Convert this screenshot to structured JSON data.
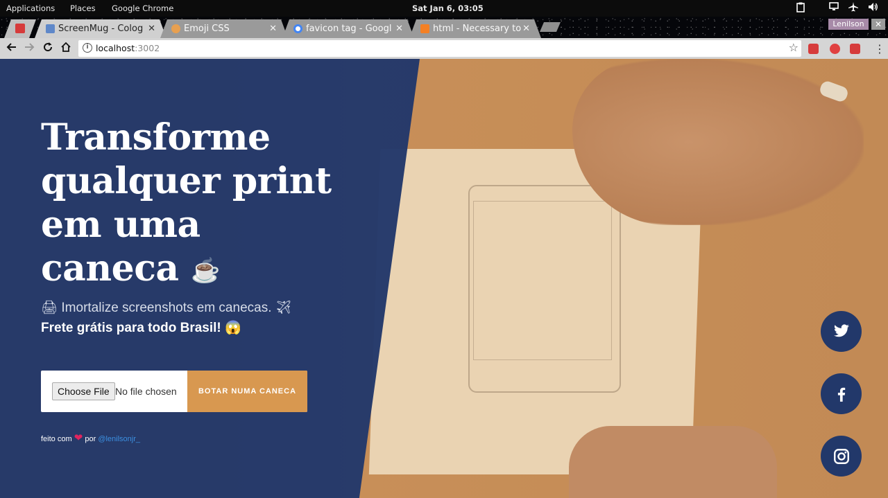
{
  "system_bar": {
    "menus": [
      "Applications",
      "Places",
      "Google Chrome"
    ],
    "clock": "Sat Jan  6, 03:05"
  },
  "browser": {
    "tabs": [
      {
        "title": "ScreenMug - Colog",
        "active": true,
        "favicon_color": "#4a6fb5"
      },
      {
        "title": "Emoji CSS",
        "active": false,
        "favicon_color": "#e8a050"
      },
      {
        "title": "favicon tag - Googl",
        "active": false,
        "favicon_color": "#4285f4"
      },
      {
        "title": "html - Necessary to",
        "active": false,
        "favicon_color": "#f48024"
      }
    ],
    "profile_name": "Lenilson",
    "url_host": "localhost",
    "url_port": ":3002"
  },
  "hero": {
    "title_lines": [
      "Transforme",
      "qualquer print",
      "em uma",
      "caneca"
    ],
    "title_emoji": "☕",
    "subtitle_emoji_1": "🖨",
    "subtitle_text": "Imortalize screenshots em canecas.",
    "subtitle_emoji_2": "✈",
    "subtitle_bold": "Frete grátis para todo Brasil!",
    "subtitle_emoji_3": "😱"
  },
  "upload": {
    "choose_label": "Choose File",
    "no_file_label": "No file chosen",
    "submit_label": "BOTAR NUMA CANECA"
  },
  "credit": {
    "prefix": "feito com",
    "heart": "❤",
    "middle": "por",
    "handle": "@lenilsonjr_"
  },
  "social": [
    "twitter-icon",
    "facebook-icon",
    "instagram-icon"
  ],
  "colors": {
    "overlay_blue": "#22386a",
    "accent_orange": "#d89850",
    "link_blue": "#3b8fe0"
  }
}
